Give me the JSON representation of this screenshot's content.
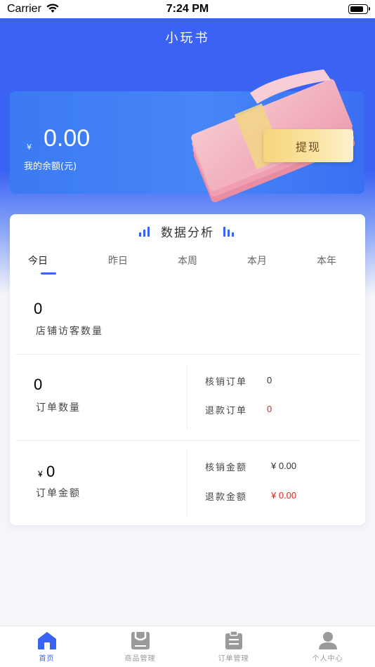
{
  "status_bar": {
    "carrier": "Carrier",
    "time": "7:24 PM"
  },
  "header": {
    "title": "小玩书"
  },
  "balance": {
    "currency_symbol": "¥",
    "amount": "0.00",
    "label": "我的余额(元)",
    "withdraw_label": "提现"
  },
  "analysis": {
    "title": "数据分析",
    "tabs": [
      "今日",
      "昨日",
      "本周",
      "本月",
      "本年"
    ],
    "active_tab": 0,
    "visitors": {
      "value": "0",
      "label": "店铺访客数量"
    },
    "orders": {
      "value": "0",
      "label": "订单数量",
      "verified_label": "核销订单",
      "verified_value": "0",
      "refund_label": "退款订单",
      "refund_value": "0"
    },
    "amount": {
      "currency": "¥",
      "value": "0",
      "label": "订单金额",
      "verified_label": "核销金额",
      "verified_value": "¥ 0.00",
      "refund_label": "退款金额",
      "refund_value": "¥ 0.00"
    }
  },
  "tabbar": {
    "items": [
      {
        "label": "首页",
        "icon": "home-icon",
        "active": true
      },
      {
        "label": "商品管理",
        "icon": "goods-icon",
        "active": false
      },
      {
        "label": "订单管理",
        "icon": "clipboard-icon",
        "active": false
      },
      {
        "label": "个人中心",
        "icon": "user-icon",
        "active": false
      }
    ]
  },
  "colors": {
    "primary": "#3a63f4",
    "refund_red": "#e2231a",
    "gold": "#f7d57c"
  }
}
